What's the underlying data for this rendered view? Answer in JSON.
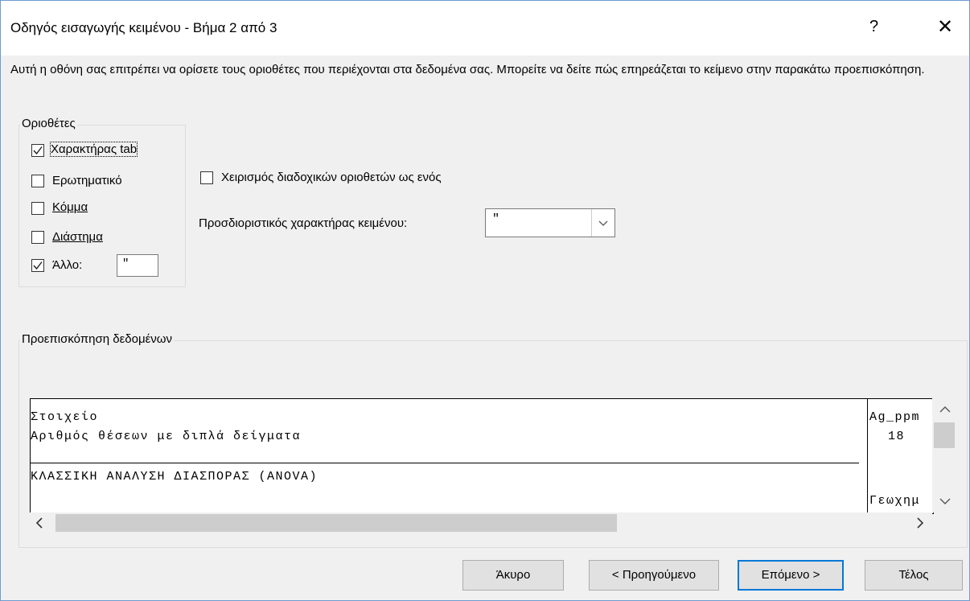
{
  "dialog": {
    "title": "Οδηγός εισαγωγής κειμένου - Βήμα 2 από 3",
    "help": "?",
    "close": "✕",
    "description": "Αυτή η οθόνη σας επιτρέπει να ορίσετε τους οριοθέτες που περιέχονται στα δεδομένα σας.  Μπορείτε να δείτε πώς επηρεάζεται το κείμενο στην παρακάτω προεπισκόπηση."
  },
  "delimiters": {
    "legend": "Οριοθέτες",
    "tab": {
      "label": "Χαρακτήρας tab",
      "checked": true
    },
    "semicolon": {
      "label": "Ερωτηματικό",
      "checked": false
    },
    "comma": {
      "label": "Κόμμα",
      "checked": false
    },
    "space": {
      "label": "Διάστημα",
      "checked": false
    },
    "other": {
      "label": "Άλλο:",
      "checked": true,
      "value": "\""
    }
  },
  "options": {
    "consecutive": {
      "label": "Χειρισμός διαδοχικών οριοθετών ως ενός",
      "checked": false
    },
    "qualifier_label": "Προσδιοριστικός χαρακτήρας κειμένου:",
    "qualifier_value": "\""
  },
  "preview": {
    "legend": "Προεπισκόπηση δεδομένων",
    "rows": [
      {
        "col1": "Στοιχείο",
        "col2": "Ag_ppm"
      },
      {
        "col1": "Αριθμός θέσεων με διπλά δείγματα",
        "col2": "18"
      },
      {
        "col1": "",
        "col2": ""
      },
      {
        "col1": "ΚΛΑΣΣΙΚΗ ΑΝΑΛΥΣΗ ΔΙΑΣΠΟΡΑΣ (ANOVA)",
        "col2": ""
      },
      {
        "col1": "",
        "col2": ""
      },
      {
        "col1": "",
        "col2": "Γεωχημ"
      }
    ],
    "scroll_up": "^",
    "scroll_down": "v",
    "scroll_left": "<",
    "scroll_right": ">"
  },
  "buttons": {
    "cancel": "Άκυρο",
    "back": "< Προηγούμενο",
    "next": "Επόμενο >",
    "finish": "Τέλος"
  },
  "colors": {
    "accent": "#0078d7",
    "border": "#6f9bd1"
  }
}
